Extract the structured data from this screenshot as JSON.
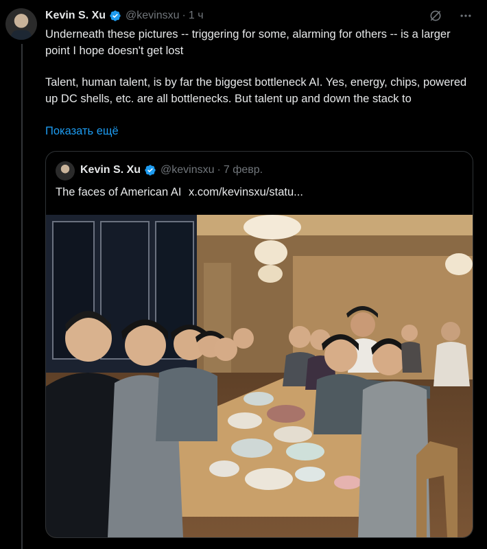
{
  "tweet": {
    "author_name": "Kevin S. Xu",
    "handle": "@kevinsxu",
    "separator": "·",
    "time": "1 ч",
    "text_line1": "Underneath these pictures -- triggering for some, alarming for others -- is a larger point I hope doesn't get lost",
    "text_line2": "Talent, human talent, is by far the biggest bottleneck AI. Yes, energy, chips, powered up DC shells, etc. are all bottlenecks. But talent up and down the stack to",
    "show_more": "Показать ещё",
    "icons": [
      "grok-icon",
      "more-icon",
      "verified-badge-icon"
    ]
  },
  "quote": {
    "author_name": "Kevin S. Xu",
    "handle": "@kevinsxu",
    "separator": "·",
    "time": "7 февр.",
    "text": "The faces of American AI",
    "link": "x.com/kevinsxu/statu..."
  },
  "colors": {
    "background": "#000000",
    "text": "#e7e9ea",
    "muted": "#71767b",
    "link": "#1d9bf0",
    "border": "#2f3336",
    "verified": "#1d9bf0"
  }
}
